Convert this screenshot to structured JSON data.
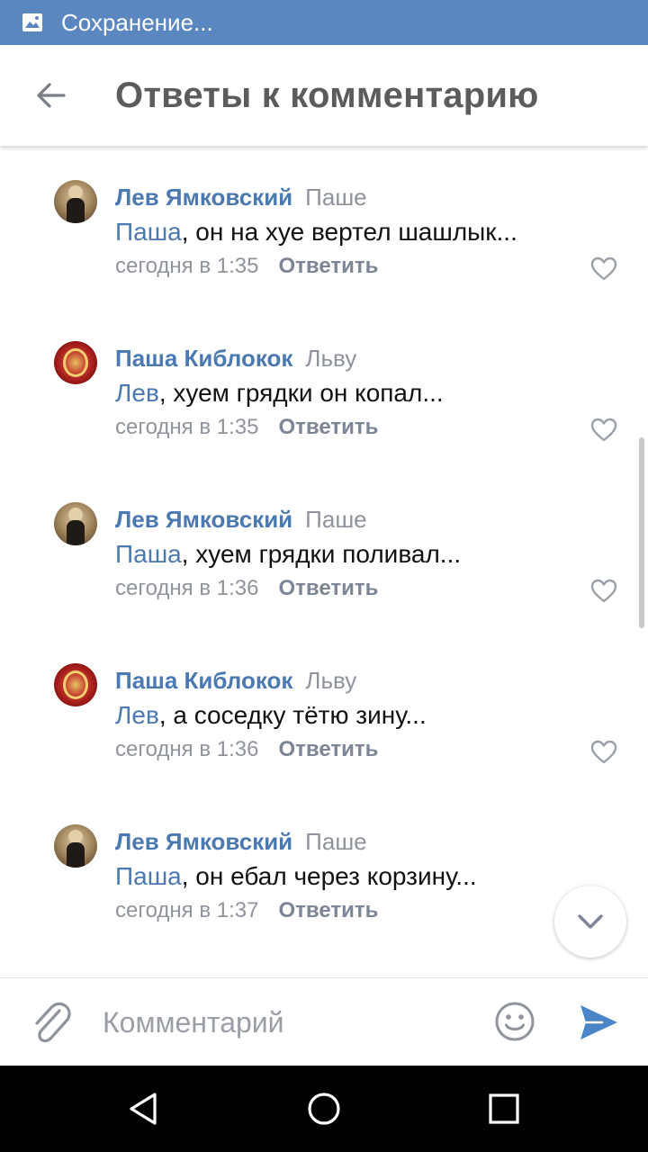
{
  "status_bar": {
    "text": "Сохранение..."
  },
  "toolbar": {
    "title": "Ответы к комментарию"
  },
  "comments": [
    {
      "author": "Лев Ямковский",
      "reply_to": "Паше",
      "mention": "Паша",
      "text": ", он на хуе вертел шашлык...",
      "time": "сегодня в 1:35",
      "reply_label": "Ответить",
      "avatar": "lev"
    },
    {
      "author": "Паша Киблокок",
      "reply_to": "Льву",
      "mention": "Лев",
      "text": ", хуем грядки он копал...",
      "time": "сегодня в 1:35",
      "reply_label": "Ответить",
      "avatar": "pasha"
    },
    {
      "author": "Лев Ямковский",
      "reply_to": "Паше",
      "mention": "Паша",
      "text": ", хуем грядки поливал...",
      "time": "сегодня в 1:36",
      "reply_label": "Ответить",
      "avatar": "lev"
    },
    {
      "author": "Паша Киблокок",
      "reply_to": "Льву",
      "mention": "Лев",
      "text": ", а соседку тётю зину...",
      "time": "сегодня в 1:36",
      "reply_label": "Ответить",
      "avatar": "pasha"
    },
    {
      "author": "Лев Ямковский",
      "reply_to": "Паше",
      "mention": "Паша",
      "text": ", он ебал через корзину...",
      "time": "сегодня в 1:37",
      "reply_label": "Ответить",
      "avatar": "lev"
    }
  ],
  "composer": {
    "placeholder": "Комментарий"
  },
  "icons": {
    "status": "image-icon",
    "back": "arrow-left-icon",
    "like": "heart-icon",
    "scroll_down": "chevron-down-icon",
    "attach": "paperclip-icon",
    "emoji": "smiley-icon",
    "send": "send-icon",
    "nav_back": "triangle-back-icon",
    "nav_home": "circle-home-icon",
    "nav_recents": "square-recents-icon"
  },
  "colors": {
    "status_bar": "#5b87c1",
    "link": "#4b79b1",
    "muted": "#8f949c",
    "send": "#4a86c7"
  }
}
